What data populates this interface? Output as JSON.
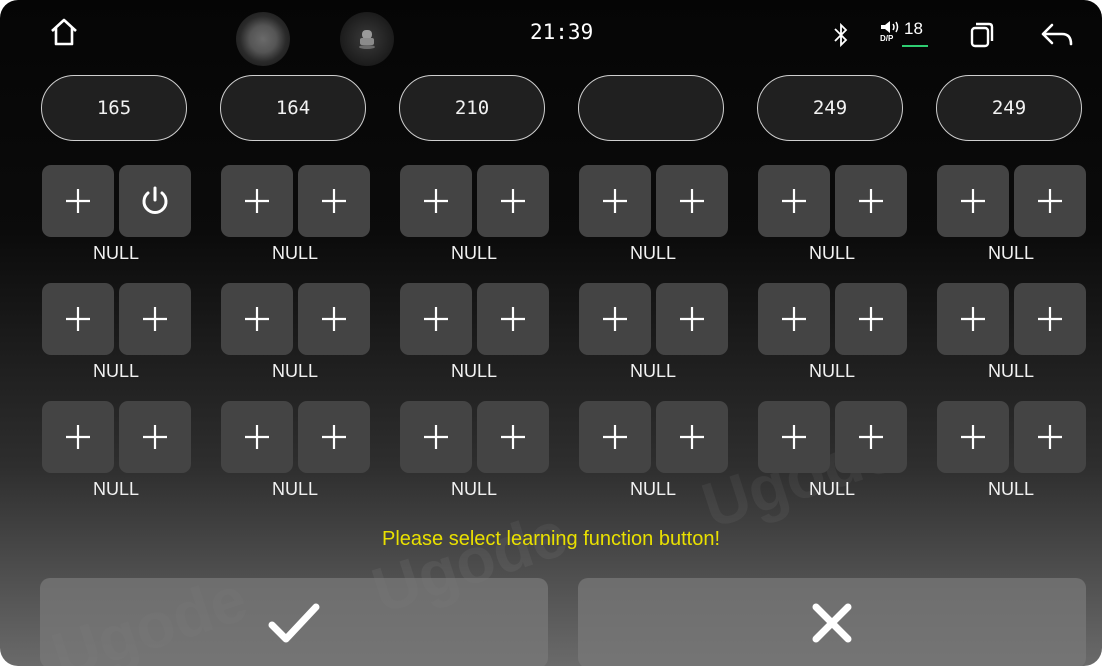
{
  "status_bar": {
    "time": "21:39",
    "volume_level": "18",
    "volume_mode": "D/P",
    "icons": [
      "home-icon",
      "microphone-orb-icon",
      "car-seat-icon",
      "bluetooth-icon",
      "volume-icon",
      "recent-apps-icon",
      "back-arrow-icon"
    ]
  },
  "channels": [
    {
      "value": "165",
      "rows": [
        {
          "left": "plus",
          "right": "power",
          "label": "NULL"
        },
        {
          "left": "plus",
          "right": "plus",
          "label": "NULL"
        },
        {
          "left": "plus",
          "right": "plus",
          "label": "NULL"
        }
      ]
    },
    {
      "value": "164",
      "rows": [
        {
          "left": "plus",
          "right": "plus",
          "label": "NULL"
        },
        {
          "left": "plus",
          "right": "plus",
          "label": "NULL"
        },
        {
          "left": "plus",
          "right": "plus",
          "label": "NULL"
        }
      ]
    },
    {
      "value": "210",
      "rows": [
        {
          "left": "plus",
          "right": "plus",
          "label": "NULL"
        },
        {
          "left": "plus",
          "right": "plus",
          "label": "NULL"
        },
        {
          "left": "plus",
          "right": "plus",
          "label": "NULL"
        }
      ]
    },
    {
      "value": "",
      "rows": [
        {
          "left": "plus",
          "right": "plus",
          "label": "NULL"
        },
        {
          "left": "plus",
          "right": "plus",
          "label": "NULL"
        },
        {
          "left": "plus",
          "right": "plus",
          "label": "NULL"
        }
      ]
    },
    {
      "value": "249",
      "rows": [
        {
          "left": "plus",
          "right": "plus",
          "label": "NULL"
        },
        {
          "left": "plus",
          "right": "plus",
          "label": "NULL"
        },
        {
          "left": "plus",
          "right": "plus",
          "label": "NULL"
        }
      ]
    },
    {
      "value": "249",
      "rows": [
        {
          "left": "plus",
          "right": "plus",
          "label": "NULL"
        },
        {
          "left": "plus",
          "right": "plus",
          "label": "NULL"
        },
        {
          "left": "plus",
          "right": "plus",
          "label": "NULL"
        }
      ]
    }
  ],
  "prompt": "Please select learning function button!",
  "actions": {
    "confirm_icon": "checkmark-icon",
    "cancel_icon": "close-icon"
  },
  "watermark": "Ugode",
  "colors": {
    "prompt": "#e9e000",
    "key": "#444444",
    "volume_indicator": "#2ecc71"
  }
}
